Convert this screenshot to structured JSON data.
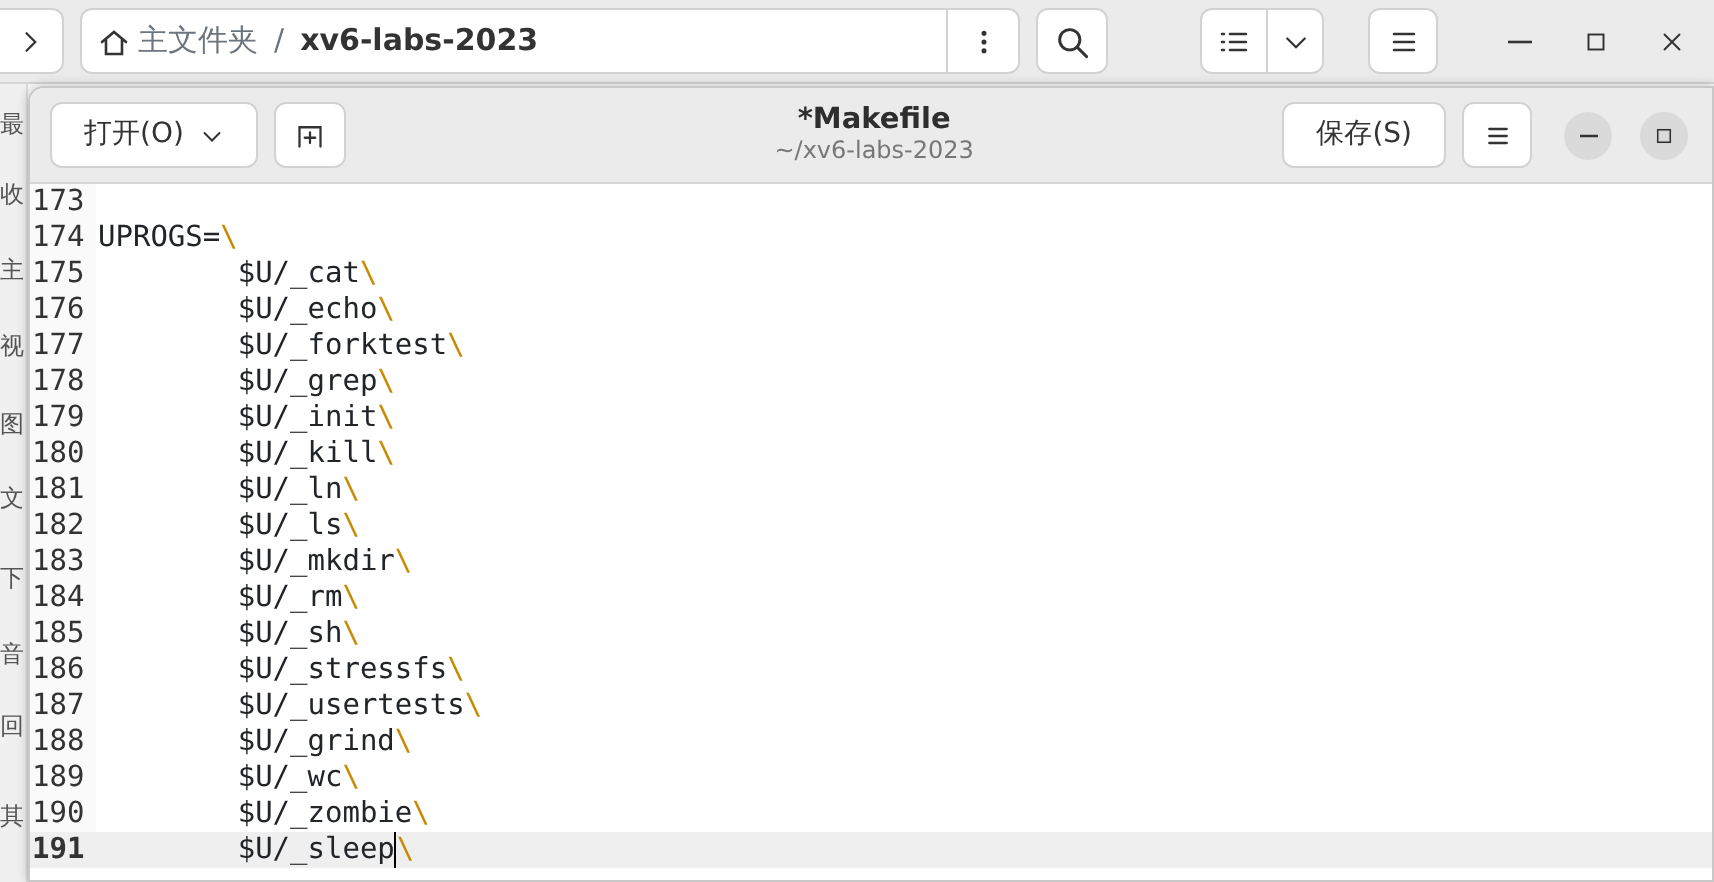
{
  "file_manager": {
    "path": {
      "home": "主文件夹",
      "separator": "/",
      "folder": "xv6-labs-2023"
    },
    "sidebar": {
      "items": [
        "最",
        "收",
        "主",
        "视",
        "图",
        "文",
        "下",
        "音",
        "回",
        "其"
      ]
    }
  },
  "editor": {
    "open_button": "打开(O)",
    "title": "*Makefile",
    "subtitle": "~/xv6-labs-2023",
    "save_button": "保存(S)",
    "lines": [
      {
        "number": "173",
        "current": false
      },
      {
        "number": "174",
        "text": "UPROGS=",
        "continuation": "\\",
        "current": false
      },
      {
        "number": "175",
        "text": "\t$U/_cat",
        "continuation": "\\",
        "current": false
      },
      {
        "number": "176",
        "text": "\t$U/_echo",
        "continuation": "\\",
        "current": false
      },
      {
        "number": "177",
        "text": "\t$U/_forktest",
        "continuation": "\\",
        "current": false
      },
      {
        "number": "178",
        "text": "\t$U/_grep",
        "continuation": "\\",
        "current": false
      },
      {
        "number": "179",
        "text": "\t$U/_init",
        "continuation": "\\",
        "current": false
      },
      {
        "number": "180",
        "text": "\t$U/_kill",
        "continuation": "\\",
        "current": false
      },
      {
        "number": "181",
        "text": "\t$U/_ln",
        "continuation": "\\",
        "current": false
      },
      {
        "number": "182",
        "text": "\t$U/_ls",
        "continuation": "\\",
        "current": false
      },
      {
        "number": "183",
        "text": "\t$U/_mkdir",
        "continuation": "\\",
        "current": false
      },
      {
        "number": "184",
        "text": "\t$U/_rm",
        "continuation": "\\",
        "current": false
      },
      {
        "number": "185",
        "text": "\t$U/_sh",
        "continuation": "\\",
        "current": false
      },
      {
        "number": "186",
        "text": "\t$U/_stressfs",
        "continuation": "\\",
        "current": false
      },
      {
        "number": "187",
        "text": "\t$U/_usertests",
        "continuation": "\\",
        "current": false
      },
      {
        "number": "188",
        "text": "\t$U/_grind",
        "continuation": "\\",
        "current": false
      },
      {
        "number": "189",
        "text": "\t$U/_wc",
        "continuation": "\\",
        "current": false
      },
      {
        "number": "190",
        "text": "\t$U/_zombie",
        "continuation": "\\",
        "current": false
      },
      {
        "number": "191",
        "text": "\t$U/_sleep",
        "continuation": "\\",
        "current": true
      }
    ]
  }
}
